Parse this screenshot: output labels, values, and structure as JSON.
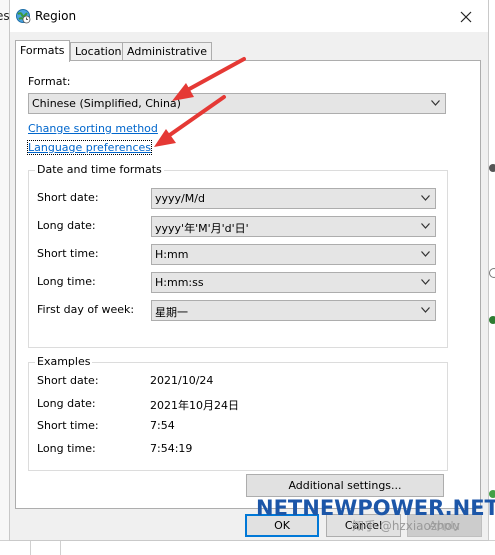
{
  "window": {
    "title": "Region"
  },
  "background": {
    "left_fragment": "es"
  },
  "tabs": [
    {
      "label": "Formats",
      "active": true
    },
    {
      "label": "Location",
      "active": false
    },
    {
      "label": "Administrative",
      "active": false
    }
  ],
  "format": {
    "label": "Format:",
    "selected": "Chinese (Simplified, China)"
  },
  "links": {
    "sorting": "Change sorting method",
    "language": "Language preferences"
  },
  "date_time_group": {
    "title": "Date and time formats",
    "rows": [
      {
        "label": "Short date:",
        "value": "yyyy/M/d"
      },
      {
        "label": "Long date:",
        "value": "yyyy'年'M'月'd'日'"
      },
      {
        "label": "Short time:",
        "value": "H:mm"
      },
      {
        "label": "Long time:",
        "value": "H:mm:ss"
      },
      {
        "label": "First day of week:",
        "value": "星期一"
      }
    ]
  },
  "examples": {
    "title": "Examples",
    "rows": [
      {
        "label": "Short date:",
        "value": "2021/10/24"
      },
      {
        "label": "Long date:",
        "value": "2021年10月24日"
      },
      {
        "label": "Short time:",
        "value": "7:54"
      },
      {
        "label": "Long time:",
        "value": "7:54:19"
      }
    ]
  },
  "buttons": {
    "additional": "Additional settings...",
    "ok": "OK",
    "cancel": "Cancel",
    "apply": "Apply"
  },
  "watermarks": {
    "logo": "NETNEWPOWER.NET",
    "zhihu": "知乎 @hzxiaozhou"
  },
  "colors": {
    "link": "#0066cc",
    "annotation_arrow": "#e53935",
    "watermark": "#1c56a8",
    "default_button_border": "#0078d7"
  }
}
